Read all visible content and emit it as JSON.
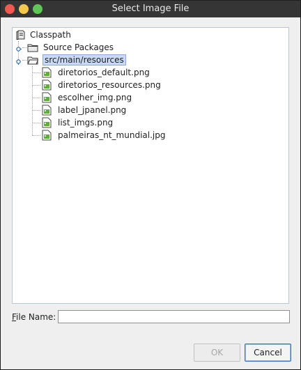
{
  "window": {
    "title": "Select Image File"
  },
  "tree": {
    "root": {
      "label": "Classpath",
      "icon": "classpath-icon"
    },
    "source_packages": {
      "label": "Source Packages",
      "icon": "folder-icon"
    },
    "resources": {
      "label": "src/main/resources",
      "icon": "folder-open-icon",
      "selected": true
    },
    "files": [
      {
        "label": "diretorios_default.png",
        "icon": "image-file-icon"
      },
      {
        "label": "diretorios_resources.png",
        "icon": "image-file-icon"
      },
      {
        "label": "escolher_img.png",
        "icon": "image-file-icon"
      },
      {
        "label": "label_jpanel.png",
        "icon": "image-file-icon"
      },
      {
        "label": "list_imgs.png",
        "icon": "image-file-icon"
      },
      {
        "label": "palmeiras_nt_mundial.jpg",
        "icon": "image-file-icon"
      }
    ]
  },
  "file_name": {
    "label_mnemonic": "F",
    "label_rest": "ile Name:",
    "value": ""
  },
  "buttons": {
    "ok": "OK",
    "cancel": "Cancel",
    "ok_enabled": false
  },
  "colors": {
    "titlebar": "#353535",
    "selection": "#c9daf2",
    "default_button_border": "#3b6fc0"
  }
}
